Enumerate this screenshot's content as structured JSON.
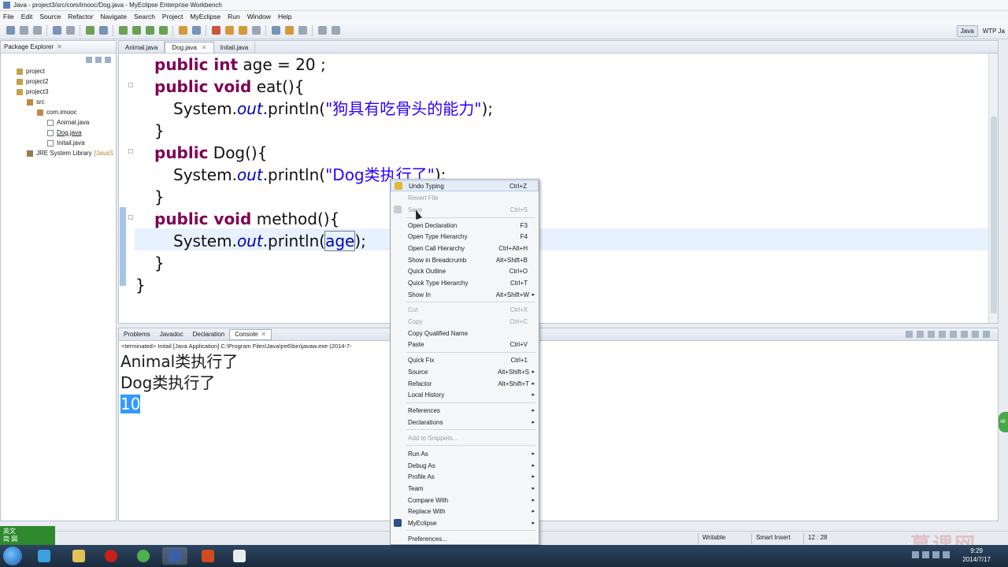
{
  "window": {
    "title": "Java - project3/src/com/imooc/Dog.java - MyEclipse Enterprise Workbench"
  },
  "menu": [
    "File",
    "Edit",
    "Source",
    "Refactor",
    "Navigate",
    "Search",
    "Project",
    "MyEclipse",
    "Run",
    "Window",
    "Help"
  ],
  "perspectives": {
    "java": "Java",
    "wtp": "WTP Ja"
  },
  "package_explorer": {
    "title": "Package Explorer",
    "items": [
      "project",
      "project2",
      "project3",
      "src",
      "com.imooc",
      "Animal.java",
      "Dog.java",
      "Initail.java",
      "JRE System Library"
    ],
    "jre_suffix": "[JavaS"
  },
  "editor": {
    "tabs": [
      "Animal.java",
      "Dog.java",
      "Initail.java"
    ],
    "code": {
      "l1_kw": "public int",
      "l1_rest": " age = 20 ;",
      "l2_kw": "public void",
      "l2_rest": " eat(){",
      "l3_a": "System.",
      "l3_out": "out",
      "l3_b": ".println(",
      "l3_str": "\"狗具有吃骨头的能力\"",
      "l3_c": ");",
      "l4": "}",
      "l5_kw": "public",
      "l5_rest": " Dog(){",
      "l6_a": "System.",
      "l6_out": "out",
      "l6_b": ".println(",
      "l6_str": "\"Dog类执行了\"",
      "l6_c": ");",
      "l7": "}",
      "l8_kw": "public void",
      "l8_rest": " method(){",
      "l9_a": "System.",
      "l9_out": "out",
      "l9_b": ".println(",
      "l9_fld": "age",
      "l9_c": ");",
      "l10": "}",
      "l11": "}"
    }
  },
  "console": {
    "tabs": [
      "Problems",
      "Javadoc",
      "Declaration",
      "Console"
    ],
    "info": "<terminated> Initail [Java Application] C:\\Program Files\\Java\\jre6\\bin\\javaw.exe (2014-7-",
    "output": [
      "Animal类执行了",
      "Dog类执行了",
      "10"
    ]
  },
  "context_menu": [
    {
      "label": "Undo Typing",
      "key": "Ctrl+Z"
    },
    {
      "label": "Revert File",
      "key": "",
      "disabled": true
    },
    {
      "label": "Save",
      "key": "Ctrl+S",
      "disabled": true
    },
    {
      "label": "Open Declaration",
      "key": "F3"
    },
    {
      "label": "Open Type Hierarchy",
      "key": "F4"
    },
    {
      "label": "Open Call Hierarchy",
      "key": "Ctrl+Alt+H"
    },
    {
      "label": "Show in Breadcrumb",
      "key": "Alt+Shift+B"
    },
    {
      "label": "Quick Outline",
      "key": "Ctrl+O"
    },
    {
      "label": "Quick Type Hierarchy",
      "key": "Ctrl+T"
    },
    {
      "label": "Show In",
      "key": "Alt+Shift+W"
    },
    {
      "label": "Cut",
      "key": "Ctrl+X",
      "disabled": true
    },
    {
      "label": "Copy",
      "key": "Ctrl+C",
      "disabled": true
    },
    {
      "label": "Copy Qualified Name",
      "key": ""
    },
    {
      "label": "Paste",
      "key": "Ctrl+V"
    },
    {
      "label": "Quick Fix",
      "key": "Ctrl+1"
    },
    {
      "label": "Source",
      "key": "Alt+Shift+S"
    },
    {
      "label": "Refactor",
      "key": "Alt+Shift+T"
    },
    {
      "label": "Local History",
      "key": ""
    },
    {
      "label": "References",
      "key": ""
    },
    {
      "label": "Declarations",
      "key": ""
    },
    {
      "label": "Add to Snippets...",
      "key": "",
      "disabled": true
    },
    {
      "label": "Run As",
      "key": ""
    },
    {
      "label": "Debug As",
      "key": ""
    },
    {
      "label": "Profile As",
      "key": ""
    },
    {
      "label": "Team",
      "key": ""
    },
    {
      "label": "Compare With",
      "key": ""
    },
    {
      "label": "Replace With",
      "key": ""
    },
    {
      "label": "MyEclipse",
      "key": ""
    },
    {
      "label": "Preferences...",
      "key": ""
    }
  ],
  "status": {
    "writable": "Writable",
    "insert": "Smart Insert",
    "position": "12 : 28"
  },
  "ime": {
    "line1": "英文",
    "line2": "简 図"
  },
  "clock": {
    "time": "9:29",
    "date": "2014/7/17"
  },
  "watermark": "慕课网",
  "badge": "48"
}
